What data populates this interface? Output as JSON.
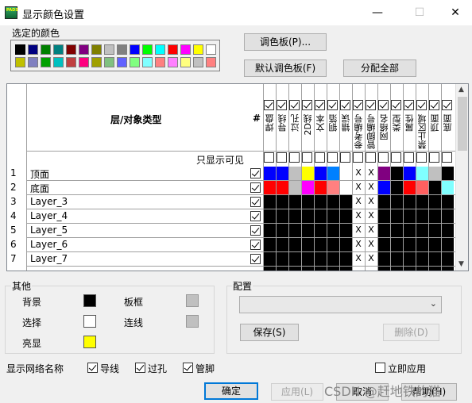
{
  "window": {
    "title": "显示颜色设置",
    "icon_text": "PADS",
    "minimize": "—",
    "maximize": "☐",
    "close": "✕"
  },
  "selected_color": {
    "label": "选定的颜色",
    "palette": [
      "#000000",
      "#000080",
      "#008000",
      "#008080",
      "#800000",
      "#800080",
      "#808000",
      "#c0c0c0",
      "#808080",
      "#0000ff",
      "#00ff00",
      "#00ffff",
      "#ff0000",
      "#ff00ff",
      "#ffff00",
      "#ffffff",
      "#c0c000",
      "#8080c0",
      "#00a000",
      "#00c0c0",
      "#c04040",
      "#ff0080",
      "#a0a000",
      "#80c080",
      "#6060ff",
      "#80ff80",
      "#80ffff",
      "#ff8080",
      "#ff80ff",
      "#ffff80",
      "#c0c0c0",
      "#ff8080"
    ],
    "selected_index": 0
  },
  "buttons": {
    "palette": "调色板(P)...",
    "default_palette": "默认调色板(F)",
    "assign_all": "分配全部",
    "save": "保存(S)",
    "delete": "删除(D)",
    "ok": "确定",
    "apply": "应用(L)",
    "cancel": "取消",
    "help": "帮助(H)"
  },
  "grid": {
    "header_type": "层/对象类型",
    "header_hash": "#",
    "visible_only_label": "只显示可见",
    "columns": [
      "焊盘",
      "导线",
      "过孔",
      "2D线",
      "文本",
      "铜箔",
      "错误",
      "参考编号",
      "管脚编号",
      "网络名",
      "类型",
      "属性",
      "禁止区域",
      "顶面",
      "底面"
    ],
    "rows": [
      {
        "num": "1",
        "name": "顶面",
        "colors": [
          "#0000ff",
          "#0000ff",
          "#c0c0c0",
          "#ffff00",
          "#0000ff",
          "#0080ff",
          "#ffffff",
          "x",
          "x",
          "#800080",
          "#000000",
          "#0000ff",
          "#80ffff",
          "#c0c0c0",
          "#000000"
        ]
      },
      {
        "num": "2",
        "name": "底面",
        "colors": [
          "#ff0000",
          "#ff0000",
          "#c0c0c0",
          "#ff00ff",
          "#ff0000",
          "#ff8080",
          "#ffffff",
          "x",
          "x",
          "#0000ff",
          "#000000",
          "#ff0000",
          "#ff6060",
          "#000000",
          "#80ffff"
        ]
      },
      {
        "num": "3",
        "name": "Layer_3",
        "colors": [
          "#000000",
          "#000000",
          "#000000",
          "#000000",
          "#000000",
          "#000000",
          "#000000",
          "x",
          "x",
          "#000000",
          "#000000",
          "#000000",
          "#000000",
          "#000000",
          "#000000"
        ]
      },
      {
        "num": "4",
        "name": "Layer_4",
        "colors": [
          "#000000",
          "#000000",
          "#000000",
          "#000000",
          "#000000",
          "#000000",
          "#000000",
          "x",
          "x",
          "#000000",
          "#000000",
          "#000000",
          "#000000",
          "#000000",
          "#000000"
        ]
      },
      {
        "num": "5",
        "name": "Layer_5",
        "colors": [
          "#000000",
          "#000000",
          "#000000",
          "#000000",
          "#000000",
          "#000000",
          "#000000",
          "x",
          "x",
          "#000000",
          "#000000",
          "#000000",
          "#000000",
          "#000000",
          "#000000"
        ]
      },
      {
        "num": "6",
        "name": "Layer_6",
        "colors": [
          "#000000",
          "#000000",
          "#000000",
          "#000000",
          "#000000",
          "#000000",
          "#000000",
          "x",
          "x",
          "#000000",
          "#000000",
          "#000000",
          "#000000",
          "#000000",
          "#000000"
        ]
      },
      {
        "num": "7",
        "name": "Layer_7",
        "colors": [
          "#000000",
          "#000000",
          "#000000",
          "#000000",
          "#000000",
          "#000000",
          "#000000",
          "x",
          "x",
          "#000000",
          "#000000",
          "#000000",
          "#000000",
          "#000000",
          "#000000"
        ]
      }
    ],
    "x_mark": "X"
  },
  "other": {
    "label": "其他",
    "items": [
      {
        "label": "背景",
        "color": "#000000"
      },
      {
        "label": "选择",
        "color": "#ffffff"
      },
      {
        "label": "亮显",
        "color": "#ffff00"
      },
      {
        "label": "板框",
        "color": "#c0c0c0"
      },
      {
        "label": "连线",
        "color": "#c0c0c0"
      }
    ]
  },
  "config": {
    "label": "配置",
    "dropdown_value": ""
  },
  "net_names": {
    "label": "显示网络名称",
    "trace": "导线",
    "via": "过孔",
    "pin": "管脚",
    "trace_checked": true,
    "via_checked": true,
    "pin_checked": true
  },
  "apply_now": {
    "label": "立即应用",
    "checked": false
  },
  "watermark": "CSDN @赶地铁的猫"
}
